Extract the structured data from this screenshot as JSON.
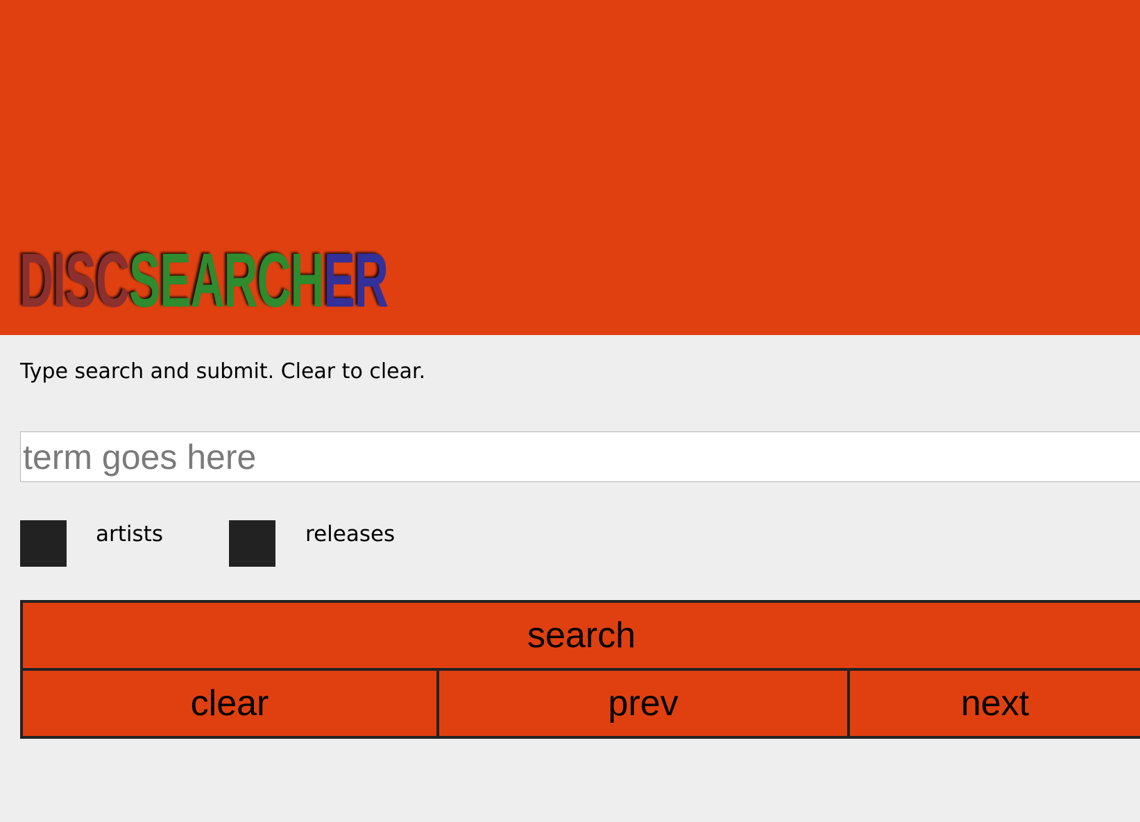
{
  "header": {
    "logo": [
      {
        "text": "DISC",
        "color": "#8b2f2f"
      },
      {
        "text": "SEARCH",
        "color": "#2e8b2e"
      },
      {
        "text": "ER",
        "color": "#33309a"
      }
    ],
    "background_color": "#e04010"
  },
  "instructions": "Type search and submit. Clear to clear.",
  "search": {
    "value": "",
    "placeholder": "term goes here"
  },
  "filters": [
    {
      "label": "artists",
      "checked": true
    },
    {
      "label": "releases",
      "checked": true
    }
  ],
  "buttons": {
    "search": "search",
    "clear": "clear",
    "prev": "prev",
    "next": "next"
  }
}
